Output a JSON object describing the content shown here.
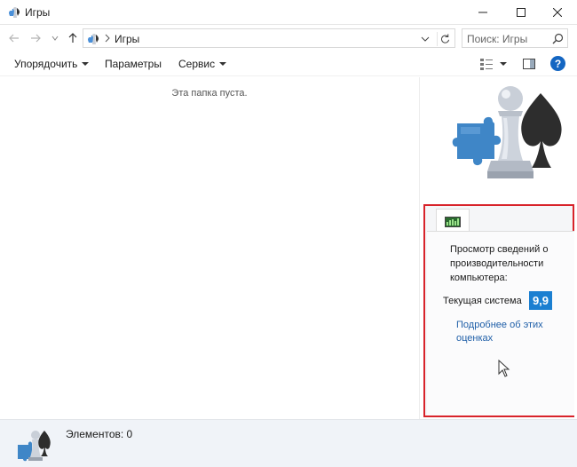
{
  "window": {
    "title": "Игры",
    "icons": {
      "app": "games-icon",
      "minimize": "minimize-icon",
      "maximize": "maximize-icon",
      "close": "close-icon"
    }
  },
  "navigation": {
    "breadcrumb": "Игры",
    "search_placeholder": "Поиск: Игры",
    "icons": [
      "back-arrow-icon",
      "forward-arrow-icon",
      "recent-dropdown-icon",
      "up-arrow-icon",
      "address-dropdown-icon",
      "refresh-icon",
      "search-icon"
    ]
  },
  "toolbar": {
    "organize": "Упорядочить",
    "options": "Параметры",
    "service": "Сервис",
    "help_glyph": "?",
    "icons": [
      "view-options-icon",
      "preview-pane-icon",
      "help-icon"
    ]
  },
  "content": {
    "empty_message": "Эта папка пуста."
  },
  "performance": {
    "title": "Просмотр сведений о производительности компьютера:",
    "current_system_label": "Текущая система",
    "score": "9,9",
    "details_link": "Подробнее об этих оценках",
    "score_color": "#1b7fd1",
    "highlight_color": "#d8232a"
  },
  "details_pane": {
    "item_count": "Элементов: 0"
  }
}
